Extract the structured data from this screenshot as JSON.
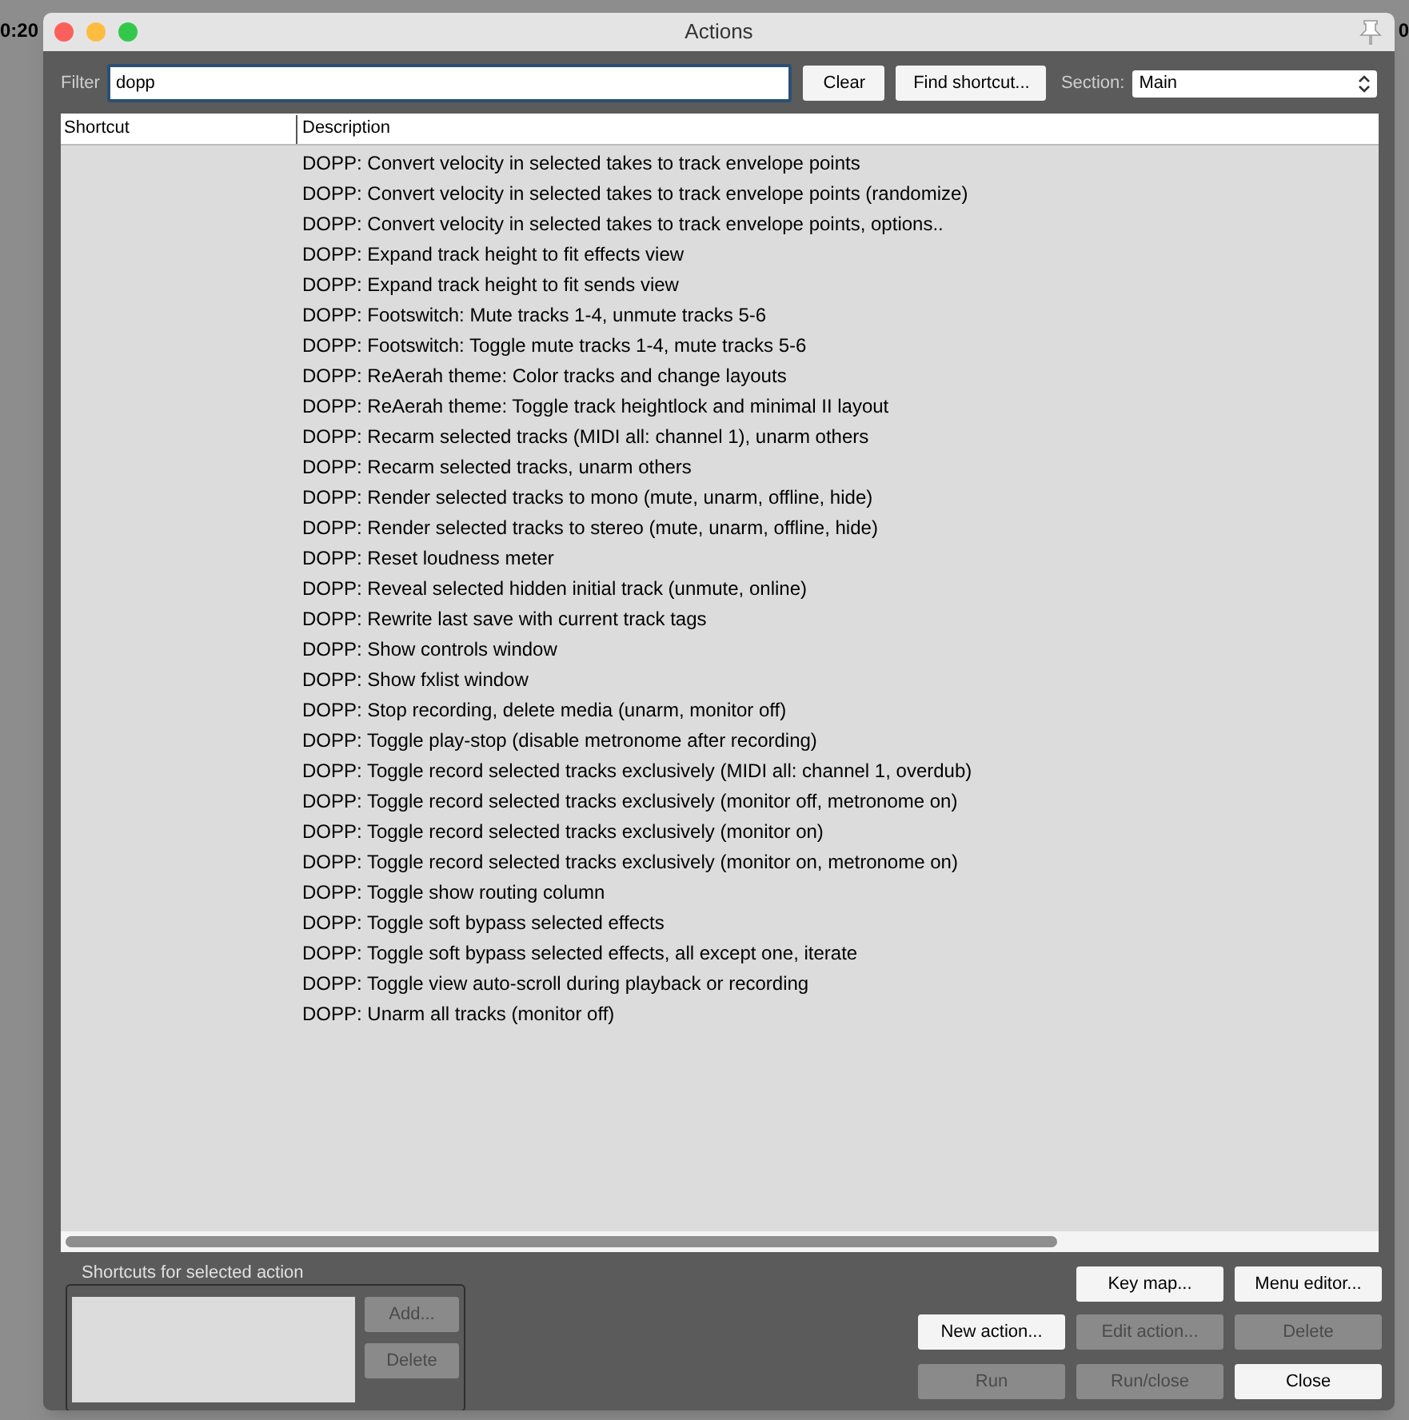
{
  "background": {
    "left_text": "0:20",
    "right_text": "0"
  },
  "window": {
    "title": "Actions"
  },
  "filter": {
    "label": "Filter",
    "value": "dopp"
  },
  "filter_buttons": [
    {
      "label": "Clear",
      "disabled": false
    },
    {
      "label": "Find shortcut...",
      "disabled": false
    }
  ],
  "section": {
    "label": "Section:",
    "value": "Main"
  },
  "table": {
    "columns": [
      "Shortcut",
      "Description"
    ],
    "rows": [
      {
        "shortcut": "",
        "description": "DOPP: Convert velocity in selected takes to track envelope points"
      },
      {
        "shortcut": "",
        "description": "DOPP: Convert velocity in selected takes to track envelope points (randomize)"
      },
      {
        "shortcut": "",
        "description": "DOPP: Convert velocity in selected takes to track envelope points, options.."
      },
      {
        "shortcut": "",
        "description": "DOPP: Expand track height to fit effects view"
      },
      {
        "shortcut": "",
        "description": "DOPP: Expand track height to fit sends view"
      },
      {
        "shortcut": "",
        "description": "DOPP: Footswitch: Mute tracks 1-4, unmute tracks 5-6"
      },
      {
        "shortcut": "",
        "description": "DOPP: Footswitch: Toggle mute tracks 1-4, mute tracks 5-6"
      },
      {
        "shortcut": "",
        "description": "DOPP: ReAerah theme: Color tracks and change layouts"
      },
      {
        "shortcut": "",
        "description": "DOPP: ReAerah theme: Toggle track heightlock and minimal II layout"
      },
      {
        "shortcut": "",
        "description": "DOPP: Recarm selected tracks (MIDI all: channel 1), unarm others"
      },
      {
        "shortcut": "",
        "description": "DOPP: Recarm selected tracks, unarm others"
      },
      {
        "shortcut": "",
        "description": "DOPP: Render selected tracks to mono (mute, unarm, offline, hide)"
      },
      {
        "shortcut": "",
        "description": "DOPP: Render selected tracks to stereo (mute, unarm, offline, hide)"
      },
      {
        "shortcut": "",
        "description": "DOPP: Reset loudness meter"
      },
      {
        "shortcut": "",
        "description": "DOPP: Reveal selected hidden initial track (unmute, online)"
      },
      {
        "shortcut": "",
        "description": "DOPP: Rewrite last save with current track tags"
      },
      {
        "shortcut": "",
        "description": "DOPP: Show controls window"
      },
      {
        "shortcut": "",
        "description": "DOPP: Show fxlist window"
      },
      {
        "shortcut": "",
        "description": "DOPP: Stop recording, delete media (unarm, monitor off)"
      },
      {
        "shortcut": "",
        "description": "DOPP: Toggle play-stop (disable metronome after recording)"
      },
      {
        "shortcut": "",
        "description": "DOPP: Toggle record selected tracks exclusively (MIDI all: channel 1, overdub)"
      },
      {
        "shortcut": "",
        "description": "DOPP: Toggle record selected tracks exclusively (monitor off, metronome on)"
      },
      {
        "shortcut": "",
        "description": "DOPP: Toggle record selected tracks exclusively (monitor on)"
      },
      {
        "shortcut": "",
        "description": "DOPP: Toggle record selected tracks exclusively (monitor on, metronome on)"
      },
      {
        "shortcut": "",
        "description": "DOPP: Toggle show routing column"
      },
      {
        "shortcut": "",
        "description": "DOPP: Toggle soft bypass selected effects"
      },
      {
        "shortcut": "",
        "description": "DOPP: Toggle soft bypass selected effects, all except one, iterate"
      },
      {
        "shortcut": "",
        "description": "DOPP: Toggle view auto-scroll during playback or recording"
      },
      {
        "shortcut": "",
        "description": "DOPP: Unarm all tracks (monitor off)"
      }
    ]
  },
  "shortcuts_panel": {
    "title": "Shortcuts for selected action",
    "buttons": [
      {
        "label": "Add...",
        "disabled": true
      },
      {
        "label": "Delete",
        "disabled": true
      }
    ]
  },
  "action_buttons": [
    [
      {
        "label": "Key map...",
        "disabled": false
      },
      {
        "label": "Menu editor...",
        "disabled": false
      }
    ],
    [
      {
        "label": "New action...",
        "disabled": false
      },
      {
        "label": "Edit action...",
        "disabled": true
      },
      {
        "label": "Delete",
        "disabled": true
      }
    ],
    [
      {
        "label": "Run",
        "disabled": true
      },
      {
        "label": "Run/close",
        "disabled": true
      },
      {
        "label": "Close",
        "disabled": false
      }
    ]
  ]
}
